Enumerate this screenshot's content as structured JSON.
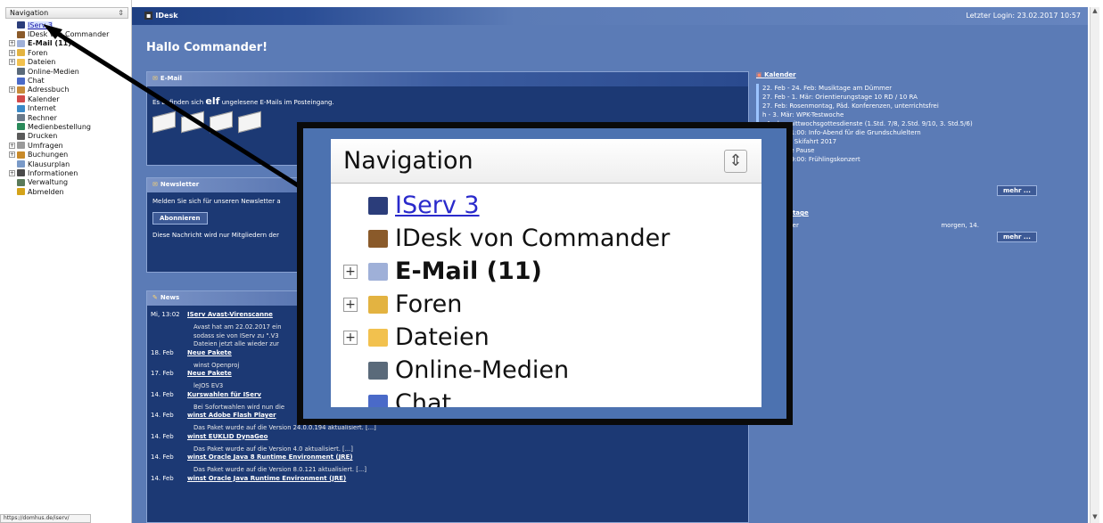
{
  "nav": {
    "title": "Navigation",
    "items": [
      {
        "label": "IServ 3",
        "expand": false,
        "icon": "iserv-icon",
        "color": "#2b3d7a",
        "state": "active"
      },
      {
        "label": "IDesk von Commander",
        "expand": false,
        "icon": "idesk-icon",
        "color": "#8a5a2a"
      },
      {
        "label": "E-Mail (11)",
        "expand": true,
        "icon": "envelope-icon",
        "color": "#9fb0d8",
        "state": "bold"
      },
      {
        "label": "Foren",
        "expand": true,
        "icon": "forum-icon",
        "color": "#e3b341"
      },
      {
        "label": "Dateien",
        "expand": true,
        "icon": "folder-icon",
        "color": "#f2c14e"
      },
      {
        "label": "Online-Medien",
        "expand": false,
        "icon": "film-icon",
        "color": "#5a6a7a"
      },
      {
        "label": "Chat",
        "expand": false,
        "icon": "chat-icon",
        "color": "#4a6ac8"
      },
      {
        "label": "Adressbuch",
        "expand": true,
        "icon": "addressbook-icon",
        "color": "#c78b3a"
      },
      {
        "label": "Kalender",
        "expand": false,
        "icon": "calendar-icon",
        "color": "#d24a4a"
      },
      {
        "label": "Internet",
        "expand": false,
        "icon": "globe-icon",
        "color": "#3a8ac8"
      },
      {
        "label": "Rechner",
        "expand": false,
        "icon": "computer-icon",
        "color": "#6a7a8a"
      },
      {
        "label": "Medienbestellung",
        "expand": false,
        "icon": "globe-icon",
        "color": "#2a8a5a"
      },
      {
        "label": "Drucken",
        "expand": false,
        "icon": "printer-icon",
        "color": "#5a5a5a"
      },
      {
        "label": "Umfragen",
        "expand": true,
        "icon": "poll-icon",
        "color": "#9a9a9a"
      },
      {
        "label": "Buchungen",
        "expand": true,
        "icon": "booking-icon",
        "color": "#c88a2a"
      },
      {
        "label": "Klausurplan",
        "expand": false,
        "icon": "plan-icon",
        "color": "#7a9ac8"
      },
      {
        "label": "Informationen",
        "expand": true,
        "icon": "info-icon",
        "color": "#4a4a4a"
      },
      {
        "label": "Verwaltung",
        "expand": false,
        "icon": "gear-icon",
        "color": "#5a7a5a"
      },
      {
        "label": "Abmelden",
        "expand": false,
        "icon": "logout-icon",
        "color": "#d4a31a"
      }
    ],
    "status_url": "https://domhus.de/iserv/"
  },
  "topbar": {
    "app_label": "IDesk",
    "last_login": "Letzter Login: 23.02.2017 10:57"
  },
  "greeting": "Hallo Commander!",
  "email_panel": {
    "title": "E-Mail",
    "text_before": "Es befinden sich",
    "count_word": "elf",
    "text_after": "ungelesene E-Mails im Posteingang."
  },
  "newsletter_panel": {
    "title": "Newsletter",
    "text": "Melden Sie sich für unseren Newsletter a",
    "button": "Abonnieren",
    "note": "Diese Nachricht wird nur Mitgliedern der"
  },
  "news_panel": {
    "title": "News",
    "rows": [
      {
        "date": "Mi, 13:02",
        "title": "IServ Avast-Virenscanne",
        "sub": [
          "Avast hat am 22.02.2017 ein",
          "sodass sie von IServ zu \".V3",
          "Dateien jetzt alle wieder zur"
        ]
      },
      {
        "date": "18. Feb",
        "title": "Neue Pakete",
        "sub": [
          "winst Openproj"
        ]
      },
      {
        "date": "17. Feb",
        "title": "Neue Pakete",
        "sub": [
          "leJOS EV3"
        ]
      },
      {
        "date": "14. Feb",
        "title": "Kurswahlen für IServ",
        "sub": [
          "Bei Sofortwahlen wird nun die"
        ]
      },
      {
        "date": "14. Feb",
        "title": "winst Adobe Flash Player",
        "sub": [
          "Das Paket wurde auf die Version 24.0.0.194 aktualisiert. [...]"
        ]
      },
      {
        "date": "14. Feb",
        "title": "winst EUKLID DynaGeo",
        "sub": [
          "Das Paket wurde auf die Version 4.0 aktualisiert. [...]"
        ]
      },
      {
        "date": "14. Feb",
        "title": "winst Oracle Java 8 Runtime Environment (JRE)",
        "sub": [
          "Das Paket wurde auf die Version 8.0.121 aktualisiert. [...]"
        ]
      },
      {
        "date": "14. Feb",
        "title": "winst Oracle Java Runtime Environment (JRE)",
        "sub": []
      }
    ]
  },
  "calendar": {
    "title": "Kalender",
    "items": [
      "22. Feb - 24. Feb: Musiktage am Dümmer",
      "27. Feb - 1. Mär: Orientierungstage 10 RD / 10 RA",
      "27. Feb: Rosenmontag, Päd. Konferenzen, unterrichtsfrei",
      "h - 3. Mär: WPK-Testwoche",
      ": Aschermittwochsgottesdienste (1.Std. 7/8, 2.Std. 9/10, 3. Std.5/6)",
      "19:00 - 21:00: Info-Abend für die Grundschuleltern",
      "- 10. Mär: Skifahrt 2017",
      ": Gesunde Pause",
      "17:00 - 19:00: Frühlingskonzert"
    ],
    "more": "mehr ..."
  },
  "birthdays": {
    "title": "rtstage",
    "name": "agler",
    "when": "morgen, 14.",
    "more": "mehr ..."
  },
  "zoom": {
    "title": "Navigation",
    "items": [
      {
        "label": "IServ 3",
        "expand": false,
        "icon": "iserv-icon",
        "color": "#2b3d7a",
        "state": "active"
      },
      {
        "label": "IDesk von Commander",
        "expand": false,
        "icon": "idesk-icon",
        "color": "#8a5a2a"
      },
      {
        "label": "E-Mail (11)",
        "expand": true,
        "icon": "envelope-icon",
        "color": "#9fb0d8",
        "state": "bold"
      },
      {
        "label": "Foren",
        "expand": true,
        "icon": "forum-icon",
        "color": "#e3b341"
      },
      {
        "label": "Dateien",
        "expand": true,
        "icon": "folder-icon",
        "color": "#f2c14e"
      },
      {
        "label": "Online-Medien",
        "expand": false,
        "icon": "film-icon",
        "color": "#5a6a7a"
      },
      {
        "label": "Chat",
        "expand": false,
        "icon": "chat-icon",
        "color": "#4a6ac8"
      }
    ]
  },
  "colors": {
    "page_bg": "#5b7bb6",
    "panel_bg": "#1c3974",
    "frame": "#0a0a0a",
    "link": "#2a2acb"
  }
}
